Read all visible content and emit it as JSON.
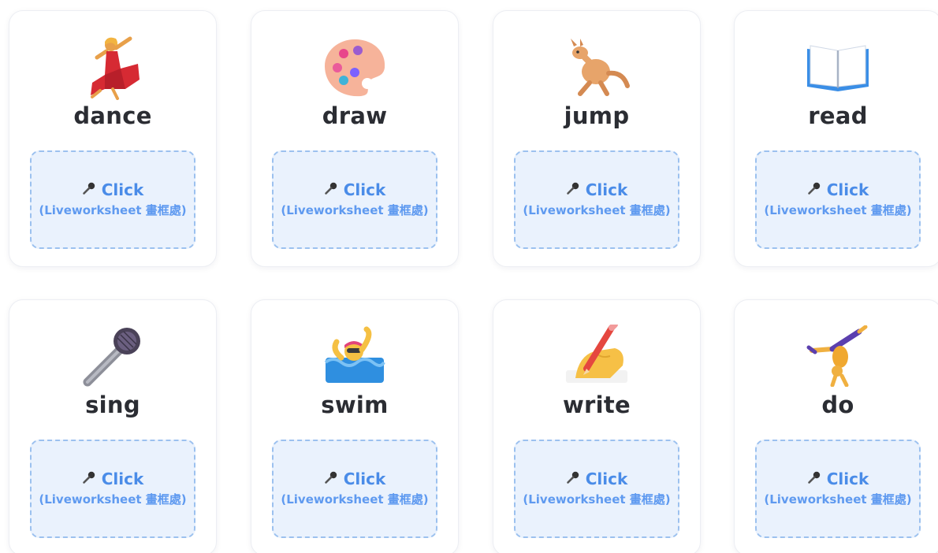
{
  "cards": [
    {
      "word": "dance",
      "icon": "dancer-icon",
      "click_label": "Click",
      "note": "(Liveworksheet 畫框處)"
    },
    {
      "word": "draw",
      "icon": "palette-icon",
      "click_label": "Click",
      "note": "(Liveworksheet 畫框處)"
    },
    {
      "word": "jump",
      "icon": "kangaroo-icon",
      "click_label": "Click",
      "note": "(Liveworksheet 畫框處)"
    },
    {
      "word": "read",
      "icon": "open-book-icon",
      "click_label": "Click",
      "note": "(Liveworksheet 畫框處)"
    },
    {
      "word": "sing",
      "icon": "microphone-icon",
      "click_label": "Click",
      "note": "(Liveworksheet 畫框處)"
    },
    {
      "word": "swim",
      "icon": "swimmer-icon",
      "click_label": "Click",
      "note": "(Liveworksheet 畫框處)"
    },
    {
      "word": "write",
      "icon": "writing-hand-icon",
      "click_label": "Click",
      "note": "(Liveworksheet 畫框處)"
    },
    {
      "word": "do",
      "icon": "cartwheel-icon",
      "click_label": "Click",
      "note": "(Liveworksheet 畫框處)"
    }
  ],
  "colors": {
    "accent": "#4a8ce8",
    "box_fill": "#eaf2fd",
    "box_border": "#9cc1ef",
    "word_text": "#2b2d33"
  }
}
